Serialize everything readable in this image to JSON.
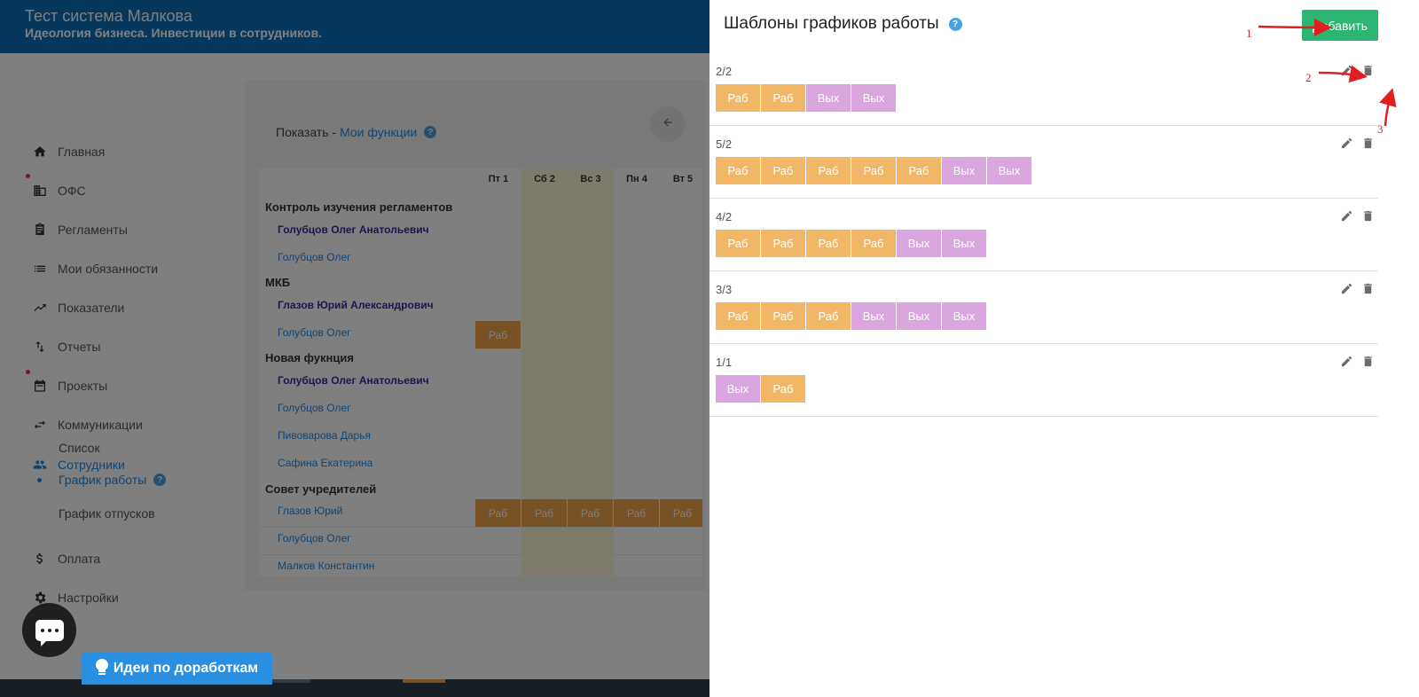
{
  "header": {
    "title": "Тест система Малкова",
    "subtitle": "Идеология бизнеса. Инвестиции в сотрудников."
  },
  "sidebar": {
    "items": [
      {
        "label": "Главная",
        "icon": "home-icon"
      },
      {
        "label": "ОФС",
        "icon": "building-icon"
      },
      {
        "label": "Регламенты",
        "icon": "clipboard-icon"
      },
      {
        "label": "Мои обязанности",
        "icon": "list-icon"
      },
      {
        "label": "Показатели",
        "icon": "trend-icon"
      },
      {
        "label": "Отчеты",
        "icon": "swap-icon"
      },
      {
        "label": "Проекты",
        "icon": "calendar-icon"
      },
      {
        "label": "Коммуникации",
        "icon": "arrows-icon"
      },
      {
        "label": "Сотрудники",
        "icon": "people-icon"
      },
      {
        "label": "Оплата",
        "icon": "dollar-icon"
      },
      {
        "label": "Настройки",
        "icon": "gear-icon"
      }
    ],
    "subitems": [
      {
        "label": "Список"
      },
      {
        "label": "График работы"
      },
      {
        "label": "График отпусков"
      }
    ]
  },
  "schedule": {
    "show_label": "Показать -",
    "show_link": "Мои функции",
    "days": [
      "Пт 1",
      "Сб 2",
      "Вс 3",
      "Пн 4",
      "Вт 5"
    ],
    "rows": [
      {
        "type": "group",
        "label": "Контроль изучения регламентов"
      },
      {
        "type": "bold",
        "label": "Голубцов Олег Анатольевич"
      },
      {
        "type": "link",
        "label": "Голубцов Олег"
      },
      {
        "type": "group",
        "label": "МКБ"
      },
      {
        "type": "bold",
        "label": "Глазов Юрий Александрович"
      },
      {
        "type": "link",
        "label": "Голубцов Олег"
      },
      {
        "type": "group",
        "label": "Новая фукнция"
      },
      {
        "type": "bold",
        "label": "Голубцов Олег Анатольевич"
      },
      {
        "type": "link",
        "label": "Голубцов Олег"
      },
      {
        "type": "link",
        "label": "Пивоварова Дарья"
      },
      {
        "type": "link",
        "label": "Сафина Екатерина"
      },
      {
        "type": "group",
        "label": "Совет учредителей"
      },
      {
        "type": "link",
        "label": "Глазов Юрий"
      },
      {
        "type": "link",
        "label": "Голубцов Олег"
      },
      {
        "type": "link",
        "label": "Малков Константин"
      }
    ],
    "cell_label": "Раб"
  },
  "widgets": {
    "ideas_label": "Идеи по доработкам"
  },
  "panel": {
    "title": "Шаблоны графиков работы",
    "add_label": "Добавить",
    "templates": [
      {
        "name": "2/2",
        "days": [
          "Раб",
          "Раб",
          "Вых",
          "Вых"
        ]
      },
      {
        "name": "5/2",
        "days": [
          "Раб",
          "Раб",
          "Раб",
          "Раб",
          "Раб",
          "Вых",
          "Вых"
        ]
      },
      {
        "name": "4/2",
        "days": [
          "Раб",
          "Раб",
          "Раб",
          "Раб",
          "Вых",
          "Вых"
        ]
      },
      {
        "name": "3/3",
        "days": [
          "Раб",
          "Раб",
          "Раб",
          "Вых",
          "Вых",
          "Вых"
        ]
      },
      {
        "name": "1/1",
        "days": [
          "Вых",
          "Раб"
        ]
      }
    ]
  },
  "annotations": [
    "1",
    "2",
    "3"
  ],
  "colors": {
    "work": "#f2b766",
    "off": "#dba6e0",
    "add_button": "#2bb673",
    "header": "#0d6fb8",
    "annotation": "#e02020"
  }
}
